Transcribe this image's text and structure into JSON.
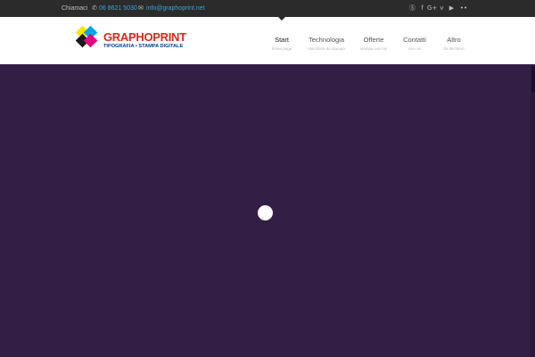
{
  "topbar": {
    "call_label": "Chiamaci",
    "phone": "06 8621 5030",
    "email": "info@graphoprint.net",
    "social": [
      {
        "name": "skype-icon",
        "glyph": "Ⓢ"
      },
      {
        "name": "facebook-icon",
        "glyph": "f"
      },
      {
        "name": "google-plus-icon",
        "glyph": "G+"
      },
      {
        "name": "vimeo-icon",
        "glyph": "v"
      },
      {
        "name": "youtube-icon",
        "glyph": "▶"
      },
      {
        "name": "flickr-icon",
        "glyph": "••"
      }
    ]
  },
  "logo": {
    "name": "GRAPHOPRINT",
    "tagline": "TIPOGRAFIA • STAMPA DIGITALE"
  },
  "nav": {
    "items": [
      {
        "label": "Start",
        "sub": "home page"
      },
      {
        "label": "Technologia",
        "sub": "macchine da stampa"
      },
      {
        "label": "Offerte",
        "sub": "stampa con noi"
      },
      {
        "label": "Contatti",
        "sub": "con noi"
      },
      {
        "label": "Altro",
        "sub": "da decidere"
      }
    ]
  },
  "colors": {
    "topbar_bg": "#2b2b2b",
    "hero_bg": "#331f45",
    "link": "#3fa2d6",
    "brand_red": "#d52b1e",
    "brand_blue": "#0a3a8f"
  }
}
